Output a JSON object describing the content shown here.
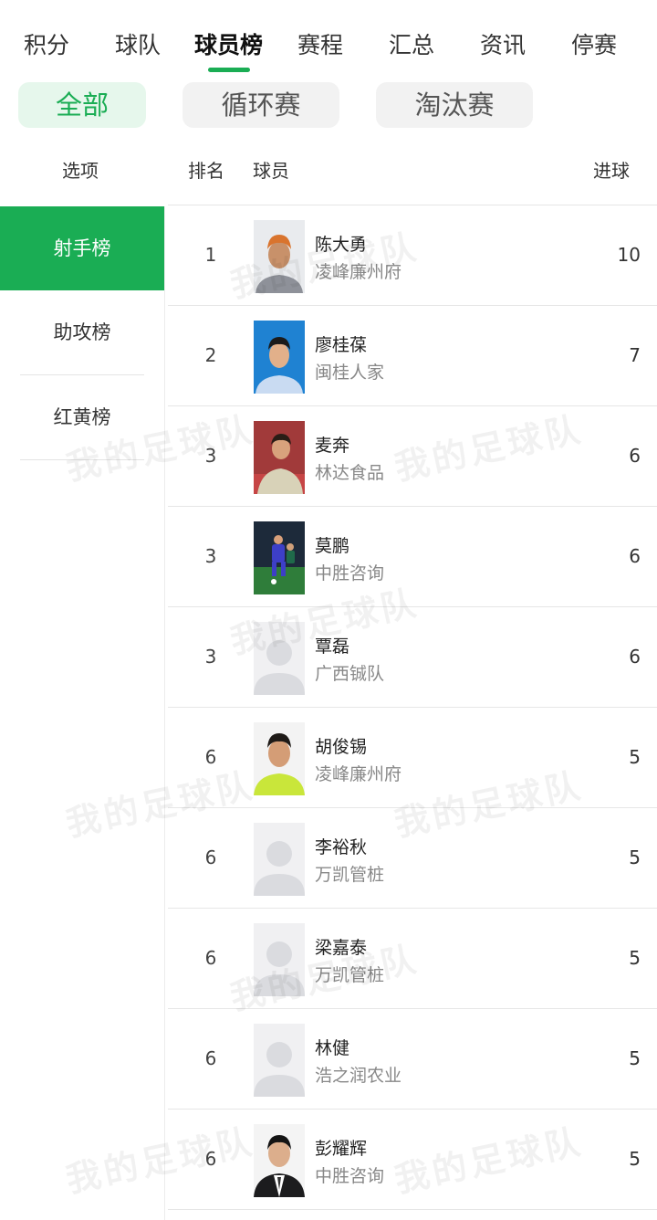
{
  "tabs": [
    {
      "label": "积分",
      "active": false
    },
    {
      "label": "球队",
      "active": false
    },
    {
      "label": "球员榜",
      "active": true
    },
    {
      "label": "赛程",
      "active": false
    },
    {
      "label": "汇总",
      "active": false
    },
    {
      "label": "资讯",
      "active": false
    },
    {
      "label": "停赛",
      "active": false
    }
  ],
  "filters": [
    {
      "label": "全部",
      "active": true
    },
    {
      "label": "循环赛",
      "active": false
    },
    {
      "label": "淘汰赛",
      "active": false
    }
  ],
  "columns": {
    "option": "选项",
    "rank": "排名",
    "player": "球员",
    "goals": "进球"
  },
  "sidebar": {
    "items": [
      {
        "label": "射手榜",
        "active": true
      },
      {
        "label": "助攻榜",
        "active": false
      },
      {
        "label": "红黄榜",
        "active": false
      }
    ]
  },
  "players": [
    {
      "rank": "1",
      "name": "陈大勇",
      "team": "凌峰廉州府",
      "goals": "10",
      "avatar": "photo-orange-hair"
    },
    {
      "rank": "2",
      "name": "廖桂葆",
      "team": "闽桂人家",
      "goals": "7",
      "avatar": "photo-blue-background"
    },
    {
      "rank": "3",
      "name": "麦奔",
      "team": "林达食品",
      "goals": "6",
      "avatar": "photo-red-background"
    },
    {
      "rank": "3",
      "name": "莫鹏",
      "team": "中胜咨询",
      "goals": "6",
      "avatar": "photo-action-shot"
    },
    {
      "rank": "3",
      "name": "覃磊",
      "team": "广西铖队",
      "goals": "6",
      "avatar": "placeholder-avatar-icon"
    },
    {
      "rank": "6",
      "name": "胡俊锡",
      "team": "凌峰廉州府",
      "goals": "5",
      "avatar": "photo-yellow-shirt"
    },
    {
      "rank": "6",
      "name": "李裕秋",
      "team": "万凯管桩",
      "goals": "5",
      "avatar": "placeholder-avatar-icon"
    },
    {
      "rank": "6",
      "name": "梁嘉泰",
      "team": "万凯管桩",
      "goals": "5",
      "avatar": "placeholder-avatar-icon"
    },
    {
      "rank": "6",
      "name": "林健",
      "team": "浩之润农业",
      "goals": "5",
      "avatar": "placeholder-avatar-icon"
    },
    {
      "rank": "6",
      "name": "彭耀辉",
      "team": "中胜咨询",
      "goals": "5",
      "avatar": "photo-suit"
    }
  ],
  "watermark": "我的足球队",
  "colors": {
    "accent": "#1aad54",
    "accent_light": "#e6f7ec"
  }
}
